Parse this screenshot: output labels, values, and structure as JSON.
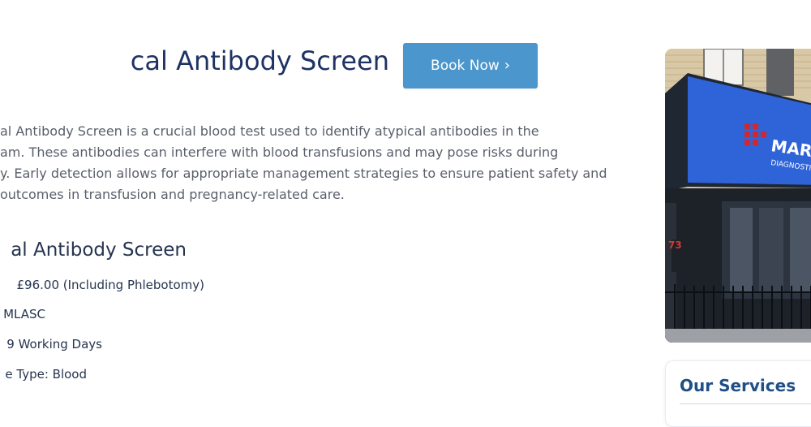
{
  "page": {
    "title": "cal Antibody Screen",
    "book_button": {
      "label": "Book Now",
      "icon": "chevron-right-icon",
      "color": "#4b96cc"
    },
    "description_lines": [
      "al Antibody Screen is a crucial blood test used to identify atypical antibodies in the",
      "am. These antibodies can interfere with blood transfusions and may pose risks during",
      "y. Early detection allows for appropriate management strategies to ensure patient safety and",
      "outcomes in transfusion and pregnancy-related care."
    ],
    "subtitle": "al Antibody Screen",
    "details": {
      "price": "£96.00 (Including Phlebotomy)",
      "lab": "MLASC",
      "turnaround": "9 Working Days",
      "sample_type": "e Type: Blood"
    }
  },
  "sidebar": {
    "photo": {
      "sign_text": "MARYL",
      "sign_subtext": "DIAGNOSTI",
      "door_number": "73",
      "sign_color": "#2f63d8"
    },
    "services_title": "Our Services"
  }
}
